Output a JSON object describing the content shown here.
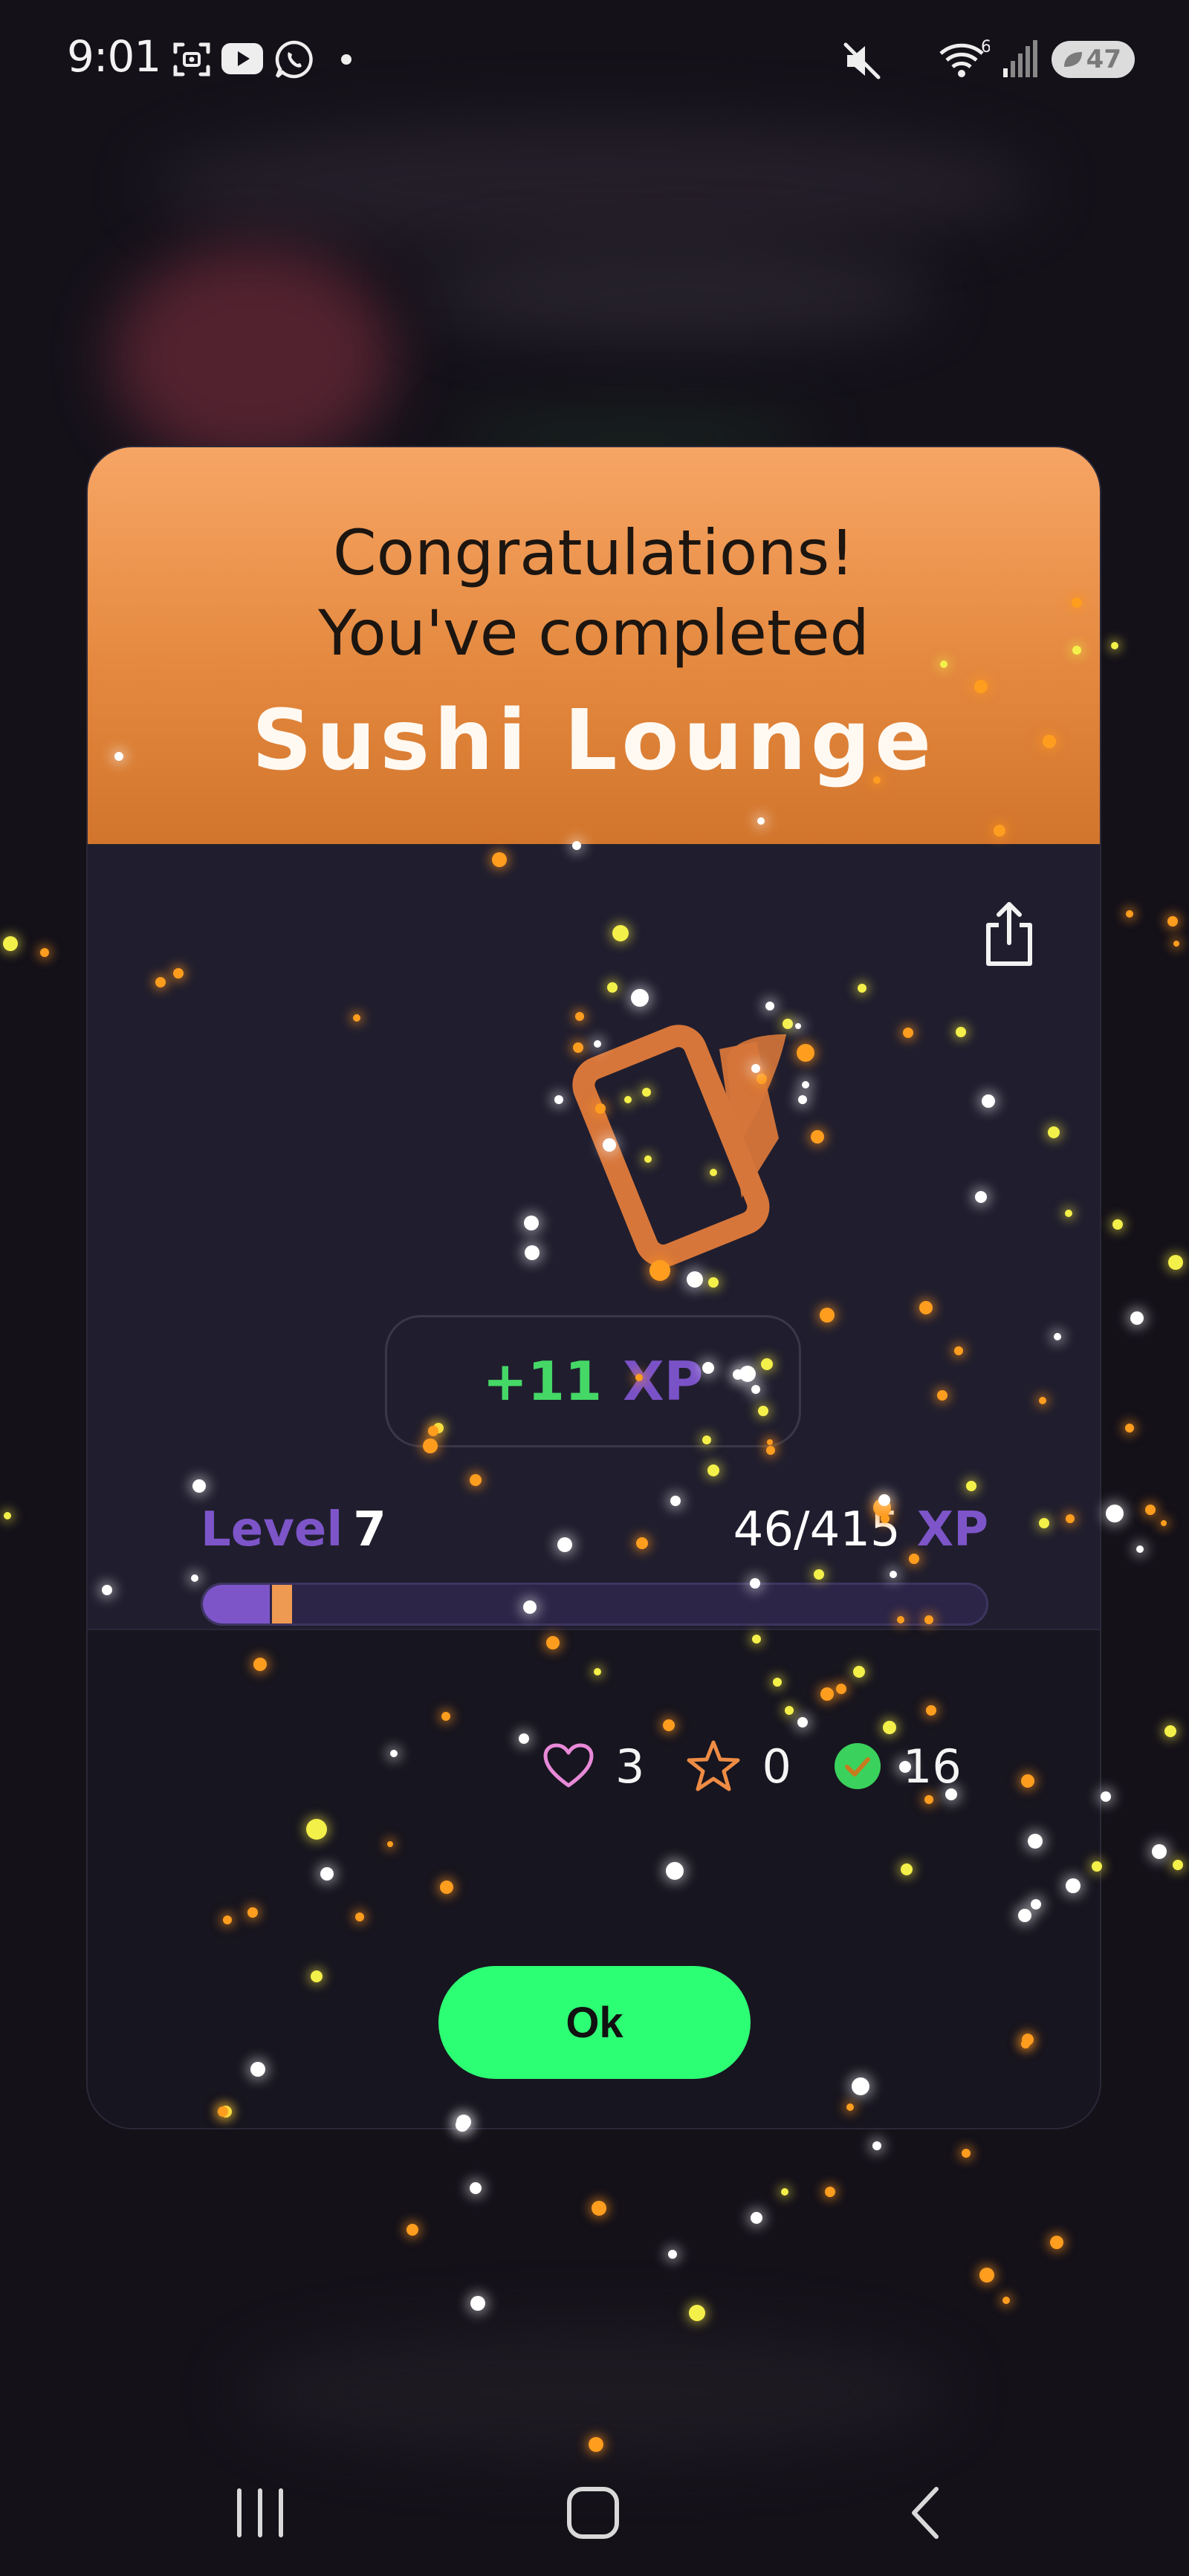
{
  "status_bar": {
    "time": "9:01",
    "battery": "47",
    "network": "6",
    "icons": [
      "screenshot-icon",
      "youtube-icon",
      "whatsapp-icon",
      "dot-icon",
      "mute-icon",
      "wifi-icon",
      "signal-icon",
      "battery-icon"
    ]
  },
  "modal": {
    "congrats_line1": "Congratulations!",
    "congrats_line2": "You've completed",
    "course_title": "Sushi Lounge",
    "share_icon": "share-icon",
    "reward_icon": "cards-icon",
    "xp_gain": {
      "amount": "+11",
      "unit": "XP"
    },
    "level": {
      "label": "Level",
      "number": "7",
      "xp_current_total": "46/415",
      "xp_unit": "XP",
      "progress_fraction": 0.111,
      "gain_fraction": 0.026
    },
    "stats": {
      "hearts": "3",
      "stars": "0",
      "completed": "16"
    },
    "ok_button": "Ok"
  },
  "colors": {
    "header_orange": "#e4893f",
    "accent_purple": "#7d55c9",
    "xp_green": "#45d867",
    "ok_green": "#2dff74",
    "modal_bg": "#201e2e"
  },
  "nav_bar": {
    "icons": [
      "recents-icon",
      "home-icon",
      "back-icon"
    ]
  }
}
